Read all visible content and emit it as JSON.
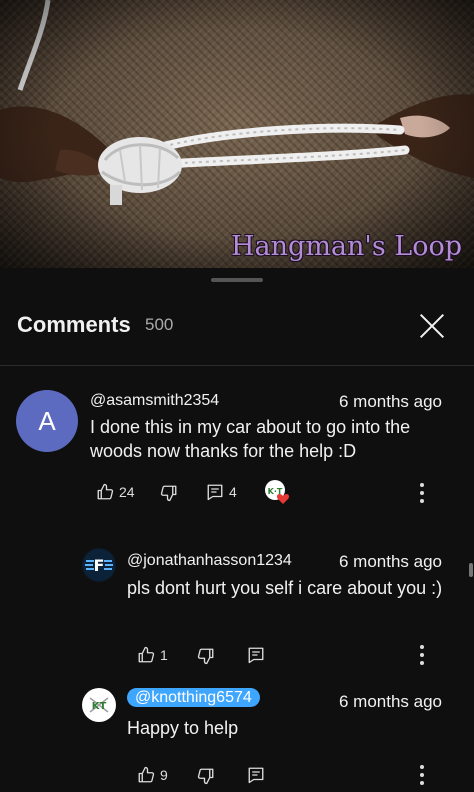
{
  "video": {
    "caption": "Hangman's Loop"
  },
  "comments_panel": {
    "title": "Comments",
    "count": "500"
  },
  "comments": [
    {
      "avatar_letter": "A",
      "author": "@asamsmith2354",
      "time": "6 months ago",
      "text": "I done this in my car about to go into the woods now thanks for the help :D",
      "likes": "24",
      "replies": "4"
    }
  ],
  "replies": [
    {
      "author": "@jonathanhasson1234",
      "time": "6 months ago",
      "text": "pls dont hurt you self i care about you :)",
      "likes": "1"
    },
    {
      "author": "@knotthing6574",
      "time": "6 months ago",
      "text": "Happy to help",
      "likes": "9"
    }
  ],
  "colors": {
    "avatar_a": "#5c6bc0",
    "creator_chip": "#3ea6ff",
    "heart": "#e53935"
  }
}
